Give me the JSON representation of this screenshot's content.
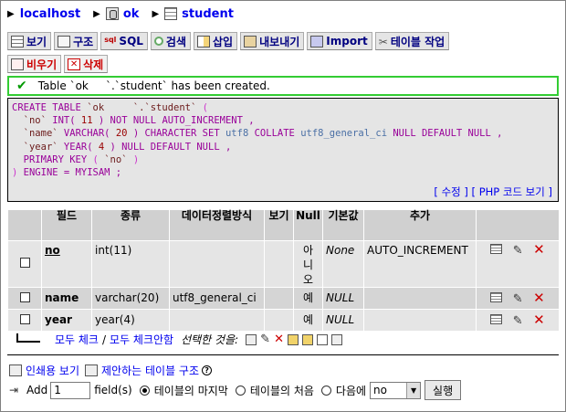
{
  "breadcrumb": {
    "server": "localhost",
    "database": "ok",
    "table": "student"
  },
  "tabs_row1": [
    {
      "label": "보기",
      "icon": "browse-icon"
    },
    {
      "label": "구조",
      "icon": "structure-icon"
    },
    {
      "label": "SQL",
      "icon": "sql-icon"
    },
    {
      "label": "검색",
      "icon": "search-icon"
    },
    {
      "label": "삽입",
      "icon": "insert-icon"
    },
    {
      "label": "내보내기",
      "icon": "export-icon"
    },
    {
      "label": "Import",
      "icon": "import-icon"
    },
    {
      "label": "테이블 작업",
      "icon": "operations-icon"
    }
  ],
  "tabs_row2": [
    {
      "label": "비우기",
      "icon": "empty-icon"
    },
    {
      "label": "삭제",
      "icon": "drop-icon"
    }
  ],
  "notice": {
    "text": "Table `ok     `.`student` has been created."
  },
  "sql": {
    "line1_a": "CREATE TABLE",
    "line1_b": "`ok     `.`student`",
    "line1_c": "(",
    "line2_a": "`no`",
    "line2_b": "INT(",
    "line2_c": "11",
    "line2_d": ")",
    "line2_e": "NOT NULL AUTO_INCREMENT ,",
    "line3_a": "`name`",
    "line3_b": "VARCHAR(",
    "line3_c": "20",
    "line3_d": ")",
    "line3_e": "CHARACTER SET",
    "line3_f": "utf8",
    "line3_g": "COLLATE",
    "line3_h": "utf8_general_ci",
    "line3_i": "NULL DEFAULT NULL ,",
    "line4_a": "`year`",
    "line4_b": "YEAR(",
    "line4_c": "4",
    "line4_d": ")",
    "line4_e": "NULL DEFAULT NULL ,",
    "line5_a": "PRIMARY KEY",
    "line5_b": "(",
    "line5_c": "`no`",
    "line5_d": ")",
    "line6_a": ")",
    "line6_b": "ENGINE = MYISAM ;",
    "link_edit": "수정",
    "link_php": "PHP 코드 보기"
  },
  "table": {
    "headers": [
      "필드",
      "종류",
      "데이터정렬방식",
      "보기",
      "Null",
      "기본값",
      "추가"
    ],
    "rows": [
      {
        "field": "no",
        "type": "int(11)",
        "collation": "",
        "attributes": "",
        "null": "아니오",
        "default": "None",
        "extra": "AUTO_INCREMENT"
      },
      {
        "field": "name",
        "type": "varchar(20)",
        "collation": "utf8_general_ci",
        "attributes": "",
        "null": "예",
        "default": "NULL",
        "extra": ""
      },
      {
        "field": "year",
        "type": "year(4)",
        "collation": "",
        "attributes": "",
        "null": "예",
        "default": "NULL",
        "extra": ""
      }
    ]
  },
  "with_selected": {
    "check_all": "모두 체크",
    "separator": "/",
    "uncheck_all": "모두 체크안함",
    "label": "선택한 것을:"
  },
  "bottom": {
    "print_view": "인쇄용 보기",
    "propose_structure": "제안하는 테이블 구조",
    "add_label": "Add",
    "add_count": "1",
    "fields_label": "field(s)",
    "at_end": "테이블의 마지막",
    "at_beginning": "테이블의 처음",
    "after": "다음에",
    "after_select": "no",
    "go_button": "실행"
  }
}
